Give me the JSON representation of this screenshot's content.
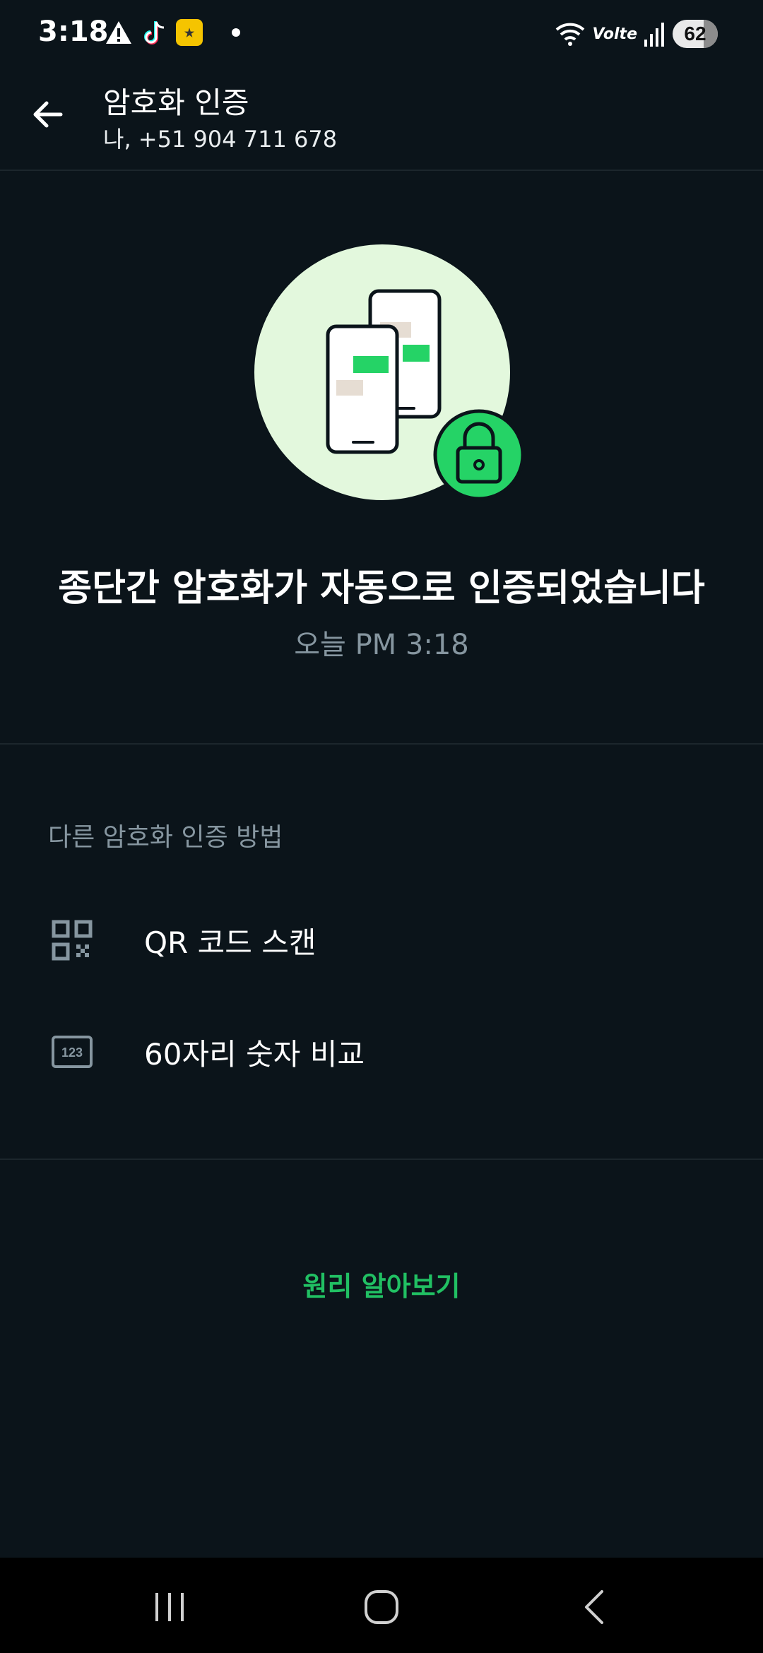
{
  "status_bar": {
    "time": "3:18",
    "battery": "62",
    "network_label": "Volte",
    "icons": [
      "warning-icon",
      "tiktok-icon",
      "app-icon",
      "notification-dot",
      "wifi-icon",
      "signal-icon",
      "battery-icon"
    ]
  },
  "header": {
    "title": "암호화 인증",
    "subtitle": "나, +51 904 711 678",
    "back_icon": "arrow-left-icon"
  },
  "illustration": {
    "description_icon": "phones-lock-icon",
    "colors": {
      "circle": "#e3f8dd",
      "green": "#25d366",
      "tan": "#e6ddd3"
    }
  },
  "main": {
    "headline": "종단간 암호화가 자동으로 인증되었습니다",
    "timestamp": "오늘 PM 3:18"
  },
  "methods": {
    "section_label": "다른 암호화 인증 방법",
    "items": [
      {
        "label": "QR 코드 스캔",
        "icon": "qr-code-icon"
      },
      {
        "label": "60자리 숫자 비교",
        "icon": "number-123-icon",
        "icon_text": "123"
      }
    ]
  },
  "footer": {
    "learn_more": "원리 알아보기",
    "accent": "#21c063"
  },
  "nav": {
    "buttons": [
      "recents-button",
      "home-button",
      "back-button"
    ]
  }
}
